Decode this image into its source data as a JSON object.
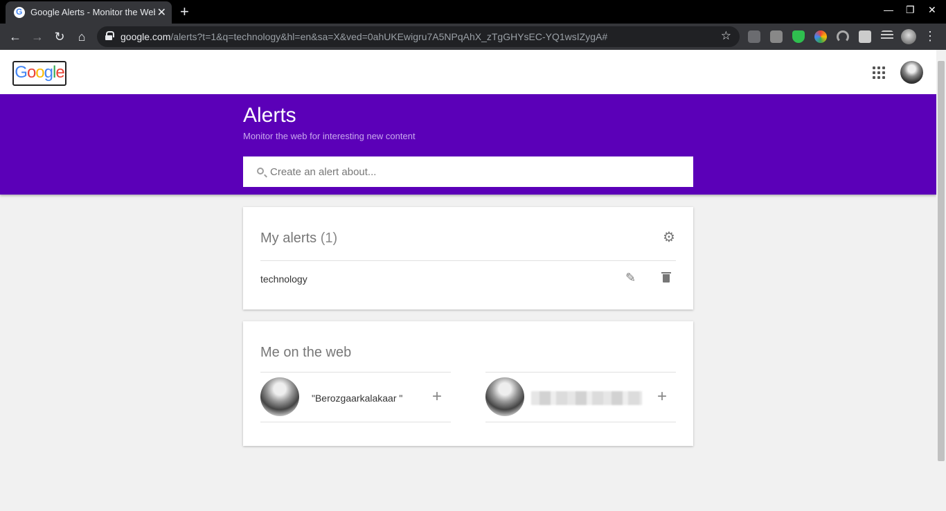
{
  "browser": {
    "tab_title": "Google Alerts - Monitor the Web",
    "close_glyph": "✕",
    "newtab_glyph": "+",
    "url_host": "google.com",
    "url_path": "/alerts?t=1&q=technology&hl=en&sa=X&ved=0ahUKEwigru7A5NPqAhX_zTgGHYsEC-YQ1wsIZygA#",
    "back_glyph": "←",
    "forward_glyph": "→",
    "reload_glyph": "↻",
    "home_glyph": "⌂",
    "star_glyph": "☆",
    "menu_glyph": "⋮",
    "minimize_glyph": "—",
    "maximize_glyph": "❐",
    "window_close_glyph": "✕"
  },
  "header": {
    "logo_letters": [
      "G",
      "o",
      "o",
      "g",
      "l",
      "e"
    ]
  },
  "banner": {
    "title": "Alerts",
    "subtitle": "Monitor the web for interesting new content",
    "search_placeholder": "Create an alert about..."
  },
  "my_alerts": {
    "title": "My alerts",
    "count": "(1)",
    "gear_glyph": "⚙",
    "items": [
      {
        "query": "technology",
        "edit_glyph": "✎"
      }
    ]
  },
  "me_on_web": {
    "title": "Me on the web",
    "plus_glyph": "+",
    "people": [
      {
        "name": "\"Berozgaarkalakaar \""
      }
    ]
  },
  "colors": {
    "banner": "#5b00b8",
    "browser_dark": "#35363a"
  }
}
